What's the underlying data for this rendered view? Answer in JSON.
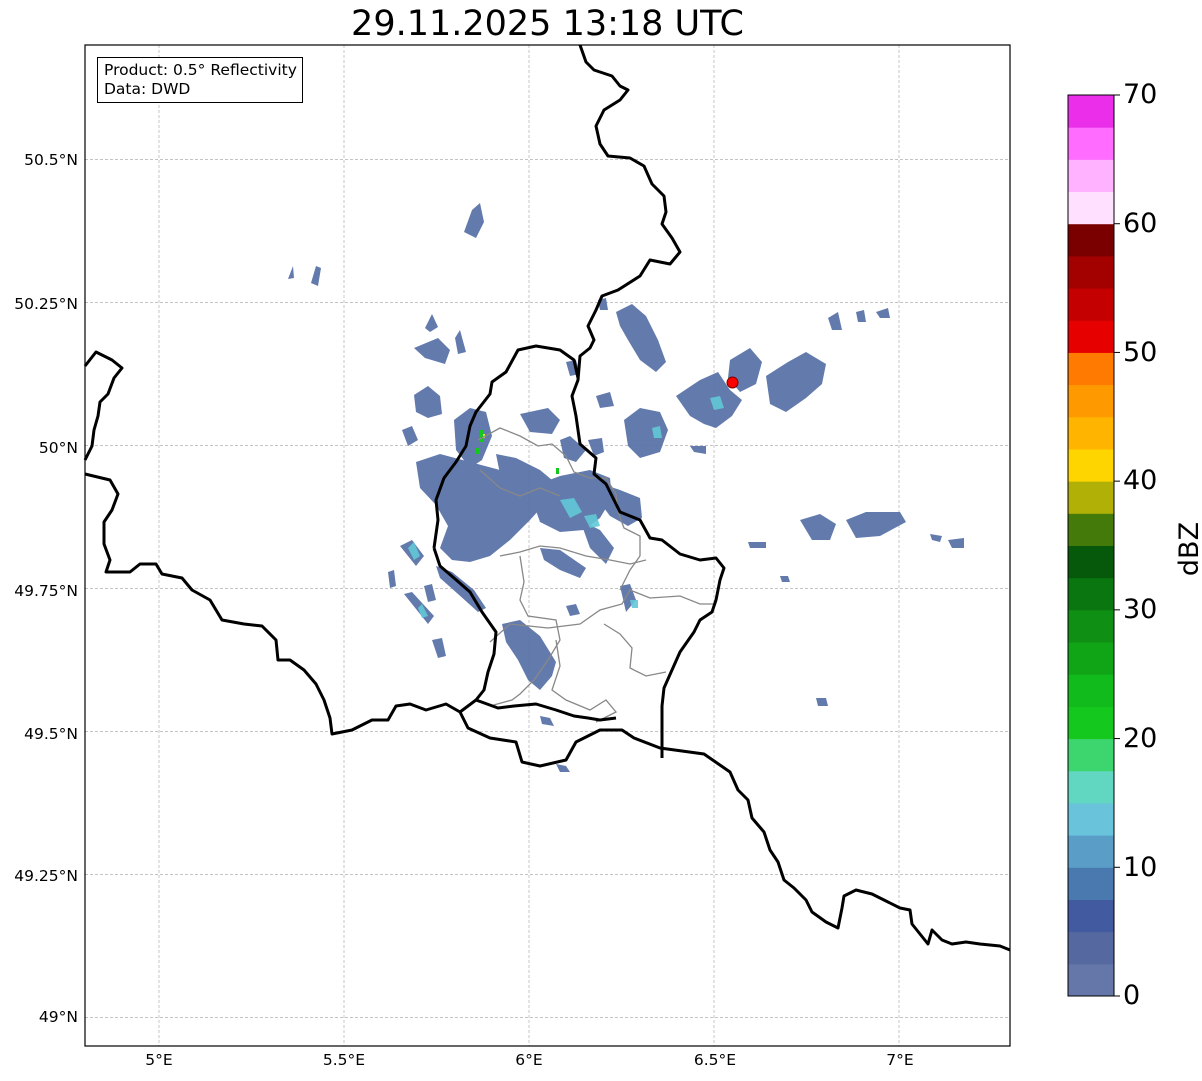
{
  "title": "29.11.2025 13:18 UTC",
  "info_box": {
    "product": "Product: 0.5° Reflectivity",
    "data": "Data: DWD"
  },
  "map": {
    "lon_range": [
      4.8,
      7.3
    ],
    "lat_range": [
      48.95,
      50.7
    ],
    "lat_ticks": [
      {
        "value": 50.5,
        "label": "50.5°N"
      },
      {
        "value": 50.25,
        "label": "50.25°N"
      },
      {
        "value": 50.0,
        "label": "50°N"
      },
      {
        "value": 49.75,
        "label": "49.75°N"
      },
      {
        "value": 49.5,
        "label": "49.5°N"
      },
      {
        "value": 49.25,
        "label": "49.25°N"
      },
      {
        "value": 49.0,
        "label": "49°N"
      }
    ],
    "lon_ticks": [
      {
        "value": 5.0,
        "label": "5°E"
      },
      {
        "value": 5.5,
        "label": "5.5°E"
      },
      {
        "value": 6.0,
        "label": "6°E"
      },
      {
        "value": 6.5,
        "label": "6.5°E"
      },
      {
        "value": 7.0,
        "label": "7°E"
      }
    ],
    "grid": true,
    "radar_site": {
      "lon": 6.55,
      "lat": 50.11,
      "color": "#ff0000"
    },
    "echo_colors": {
      "light": "#5b73a8",
      "mid": "#4a78b0",
      "cyan": "#62c8d8",
      "green": "#14c81e"
    }
  },
  "colorbar": {
    "label": "dBZ",
    "min": 0,
    "max": 70,
    "step": 2.5,
    "ticks": [
      "0",
      "10",
      "20",
      "30",
      "40",
      "50",
      "60",
      "70"
    ],
    "colors": [
      "#6577a8",
      "#55689f",
      "#425aa0",
      "#4a79b0",
      "#5a9ec8",
      "#68c3db",
      "#61d6c1",
      "#3dd66e",
      "#14c81e",
      "#12bb1c",
      "#10a517",
      "#0f9014",
      "#0a7610",
      "#06590b",
      "#447a09",
      "#b0b007",
      "#ffd500",
      "#ffb500",
      "#ff9900",
      "#ff7a00",
      "#e60000",
      "#c40000",
      "#a30000",
      "#7a0000",
      "#ffe0ff",
      "#ffb2ff",
      "#ff6cff",
      "#ea2ee9"
    ]
  }
}
